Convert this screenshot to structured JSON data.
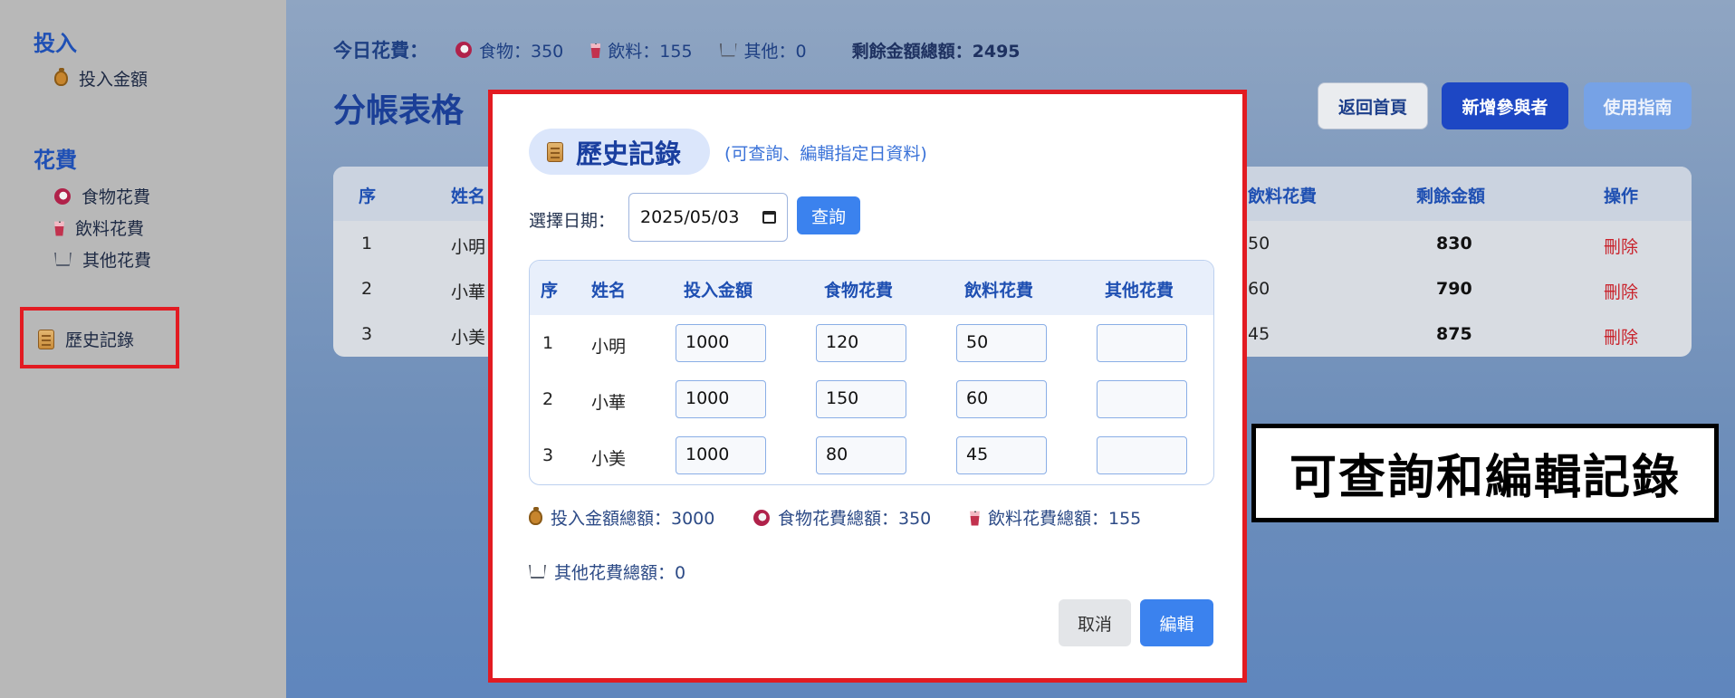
{
  "sidebar": {
    "sections": [
      {
        "title": "投入",
        "items": [
          {
            "icon": "money-bag-icon",
            "label": "投入金額"
          }
        ]
      },
      {
        "title": "花費",
        "items": [
          {
            "icon": "food-icon",
            "label": "食物花費"
          },
          {
            "icon": "drink-icon",
            "label": "飲料花費"
          },
          {
            "icon": "cart-icon",
            "label": "其他花費"
          }
        ]
      }
    ],
    "history": {
      "icon": "scroll-icon",
      "label": "歷史記錄"
    }
  },
  "header": {
    "today_label": "今日花費：",
    "food": "食物：350",
    "drink": "飲料：155",
    "other": "其他：0",
    "remaining": "剩餘金額總額：2495"
  },
  "page_title": "分帳表格",
  "toolbar": {
    "home": "返回首頁",
    "add": "新增參與者",
    "guide": "使用指南"
  },
  "main_table": {
    "headers": {
      "seq": "序",
      "name": "姓名",
      "drink": "飲料花費",
      "remaining": "剩餘金額",
      "action": "操作"
    },
    "rows": [
      {
        "seq": "1",
        "name": "小明",
        "drink": "50",
        "remaining": "830",
        "action": "刪除"
      },
      {
        "seq": "2",
        "name": "小華",
        "drink": "60",
        "remaining": "790",
        "action": "刪除"
      },
      {
        "seq": "3",
        "name": "小美",
        "drink": "45",
        "remaining": "875",
        "action": "刪除"
      }
    ]
  },
  "modal": {
    "title": "歷史記錄",
    "subtitle": "(可查詢、編輯指定日資料)",
    "date_label": "選擇日期：",
    "date_value": "2025/05/03",
    "query": "查詢",
    "table": {
      "headers": [
        "序",
        "姓名",
        "投入金額",
        "食物花費",
        "飲料花費",
        "其他花費"
      ],
      "rows": [
        {
          "seq": "1",
          "name": "小明",
          "invest": "1000",
          "food": "120",
          "drink": "50",
          "other": ""
        },
        {
          "seq": "2",
          "name": "小華",
          "invest": "1000",
          "food": "150",
          "drink": "60",
          "other": ""
        },
        {
          "seq": "3",
          "name": "小美",
          "invest": "1000",
          "food": "80",
          "drink": "45",
          "other": ""
        }
      ]
    },
    "totals": {
      "invest": "投入金額總額：3000",
      "food": "食物花費總額：350",
      "drink": "飲料花費總額：155",
      "other": "其他花費總額：0"
    },
    "cancel": "取消",
    "edit": "編輯"
  },
  "callout": "可查詢和編輯記錄",
  "colors": {
    "accent": "#3b82ee",
    "primary": "#1d47c4",
    "highlight": "#e21b22",
    "delete": "#c9232c"
  }
}
